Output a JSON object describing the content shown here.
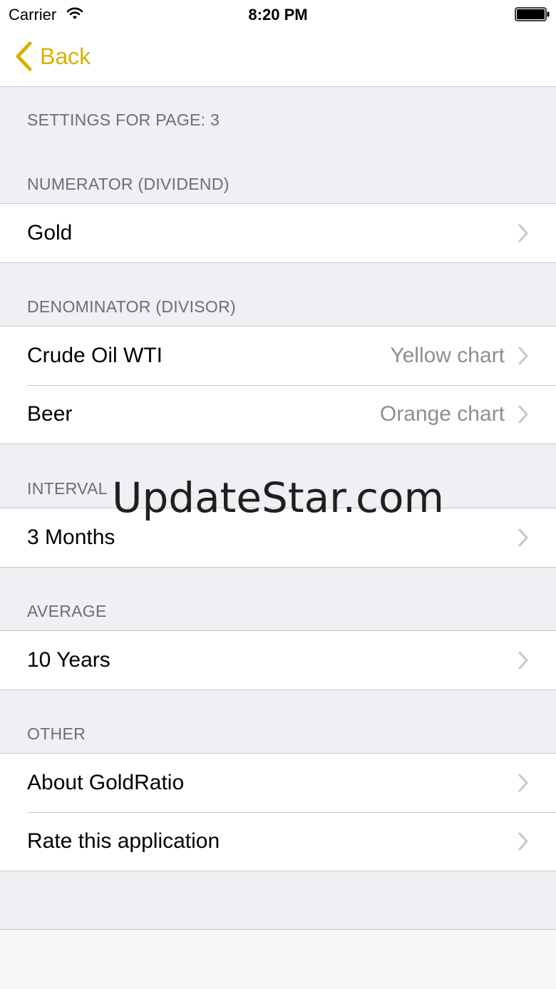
{
  "status_bar": {
    "carrier": "Carrier",
    "time": "8:20 PM",
    "wifi_icon": "wifi-icon",
    "battery_icon": "battery-icon"
  },
  "nav": {
    "back_label": "Back",
    "back_icon": "chevron-left-icon",
    "accent_color": "#d9b100"
  },
  "sections": {
    "title_header": "SETTINGS FOR PAGE: 3",
    "numerator": {
      "header": "NUMERATOR (DIVIDEND)",
      "rows": [
        {
          "title": "Gold"
        }
      ]
    },
    "denominator": {
      "header": "DENOMINATOR (DIVISOR)",
      "rows": [
        {
          "title": "Crude Oil WTI",
          "detail": "Yellow chart"
        },
        {
          "title": "Beer",
          "detail": "Orange chart"
        }
      ]
    },
    "interval": {
      "header": "INTERVAL",
      "rows": [
        {
          "title": "3 Months"
        }
      ]
    },
    "average": {
      "header": "AVERAGE",
      "rows": [
        {
          "title": "10 Years"
        }
      ]
    },
    "other": {
      "header": "OTHER",
      "rows": [
        {
          "title": "About GoldRatio"
        },
        {
          "title": "Rate this application"
        }
      ]
    }
  },
  "watermark": "UpdateStar.com",
  "colors": {
    "grouped_background": "#efeff4",
    "separator": "#c8c7cc",
    "header_text": "#6d6d72",
    "detail_text": "#8e8e93",
    "chevron": "#c7c7cc"
  }
}
